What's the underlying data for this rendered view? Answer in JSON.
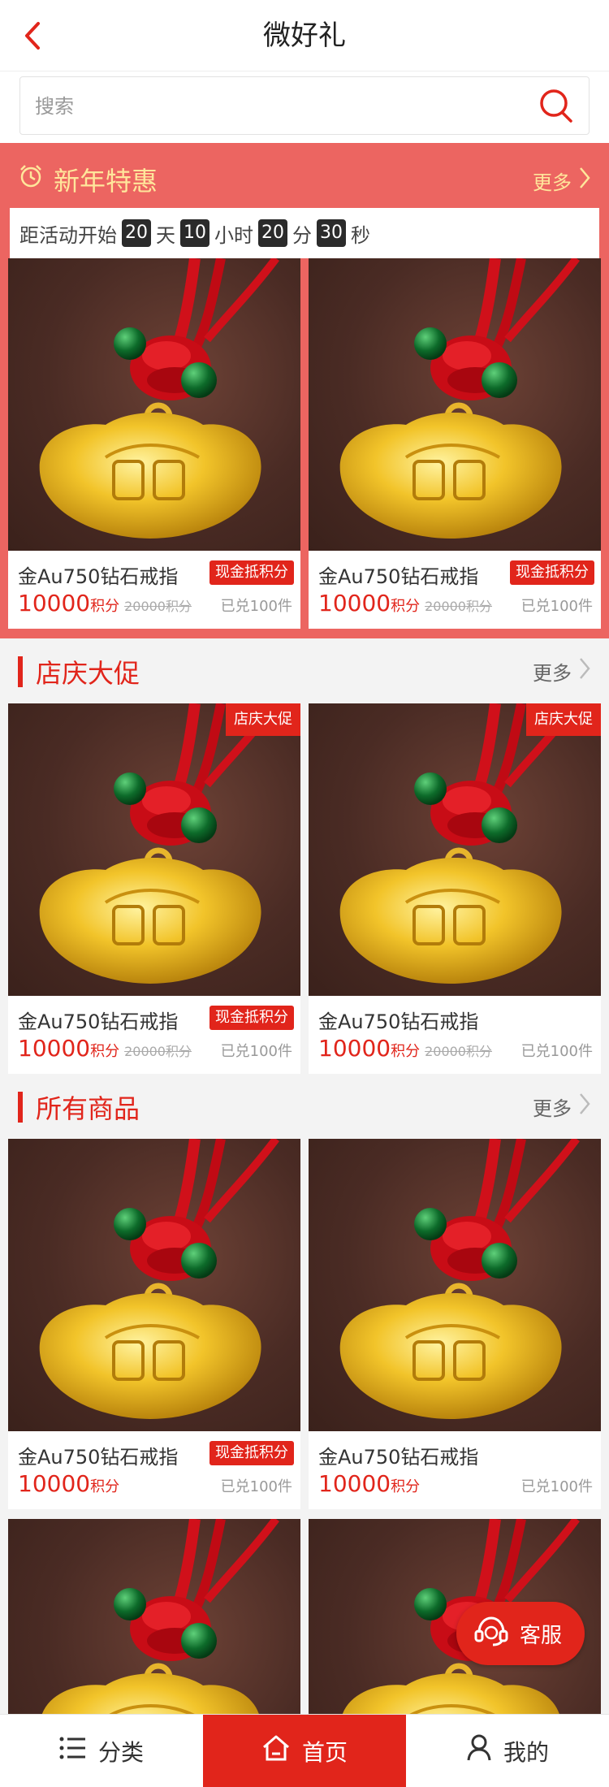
{
  "header": {
    "title": "微好礼"
  },
  "search": {
    "placeholder": "搜索"
  },
  "promo": {
    "title": "新年特惠",
    "more": "更多",
    "countdown": {
      "prefix": "距活动开始",
      "days": "20",
      "days_unit": "天",
      "hours": "10",
      "hours_unit": "小时",
      "minutes": "20",
      "minutes_unit": "分",
      "seconds": "30",
      "seconds_unit": "秒"
    },
    "items": [
      {
        "name": "金Au750钻石戒指",
        "tag": "现金抵积分",
        "price": "10000",
        "unit": "积分",
        "old_price": "20000积分",
        "sold": "已兑100件"
      },
      {
        "name": "金Au750钻石戒指",
        "tag": "现金抵积分",
        "price": "10000",
        "unit": "积分",
        "old_price": "20000积分",
        "sold": "已兑100件"
      }
    ]
  },
  "section1": {
    "title": "店庆大促",
    "more": "更多",
    "items": [
      {
        "corner": "店庆大促",
        "name": "金Au750钻石戒指",
        "tag": "现金抵积分",
        "price": "10000",
        "unit": "积分",
        "old_price": "20000积分",
        "sold": "已兑100件"
      },
      {
        "corner": "店庆大促",
        "name": "金Au750钻石戒指",
        "price": "10000",
        "unit": "积分",
        "old_price": "20000积分",
        "sold": "已兑100件"
      }
    ]
  },
  "section2": {
    "title": "所有商品",
    "more": "更多",
    "items": [
      {
        "name": "金Au750钻石戒指",
        "tag": "现金抵积分",
        "price": "10000",
        "unit": "积分",
        "sold": "已兑100件"
      },
      {
        "name": "金Au750钻石戒指",
        "price": "10000",
        "unit": "积分",
        "sold": "已兑100件"
      }
    ]
  },
  "service": {
    "label": "客服"
  },
  "tabbar": {
    "tabs": [
      {
        "label": "分类"
      },
      {
        "label": "首页"
      },
      {
        "label": "我的"
      }
    ],
    "active": "首页"
  },
  "colors": {
    "accent": "#e1251b",
    "promo_bg": "#ec6561",
    "promo_text": "#ffe69b"
  }
}
